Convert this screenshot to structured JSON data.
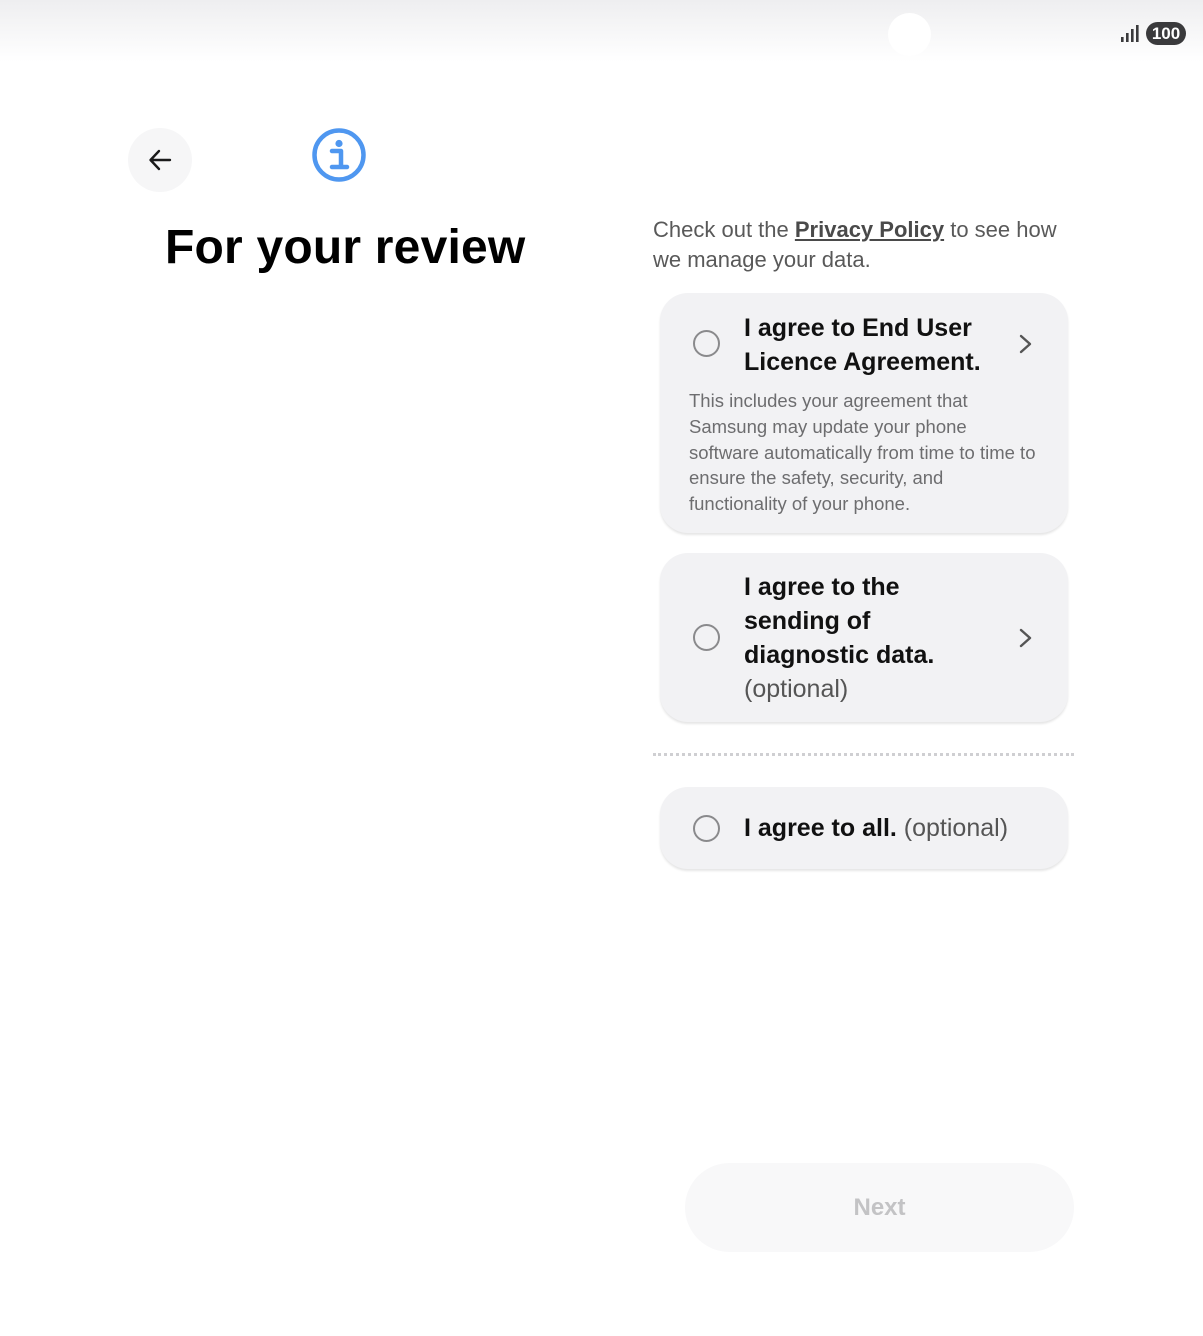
{
  "status_bar": {
    "battery_level": "100",
    "signal_icon": "cellular-signal-icon"
  },
  "header": {
    "back_icon": "arrow-left-icon",
    "info_icon": "info-icon",
    "title": "For your review"
  },
  "intro": {
    "prefix": "Check out the ",
    "link_label": "Privacy Policy",
    "suffix": " to see how we manage your data."
  },
  "agreements": [
    {
      "title": "I agree to End User Licence Agreement.",
      "optional": "",
      "description": "This includes your agreement that Samsung may update your phone software automatically from time to time to ensure the safety, security, and functionality of your phone.",
      "checked": false
    },
    {
      "title": "I agree to the sending of diagnostic data.",
      "optional": "(optional)",
      "description": "",
      "checked": false
    }
  ],
  "agree_all": {
    "title": "I agree to all.",
    "optional": "(optional)",
    "checked": false
  },
  "footer": {
    "next_label": "Next"
  },
  "colors": {
    "info_accent": "#4f97f0",
    "card_background": "#f2f2f4",
    "disabled_text": "#c3c3c5"
  }
}
